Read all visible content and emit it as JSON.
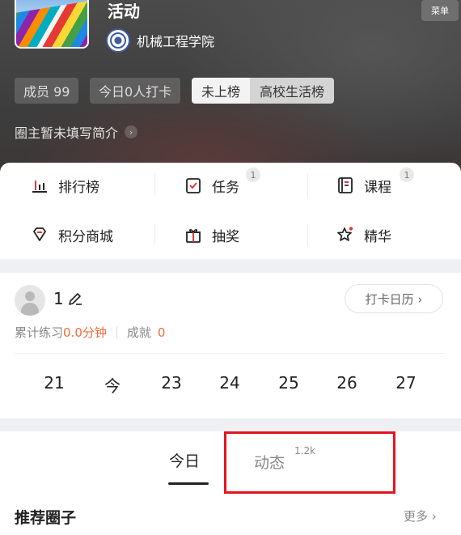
{
  "header": {
    "title": "活动",
    "menu_label": "菜单",
    "college_name": "机械工程学院",
    "members": "成员 99",
    "checkins_today": "今日0人打卡",
    "rank_not_listed": "未上榜",
    "rank_campus": "高校生活榜",
    "intro": "圈主暂未填写简介",
    "intro_chevron": "›"
  },
  "features": [
    {
      "label": "排行榜",
      "icon": "bar-chart-icon",
      "badge": ""
    },
    {
      "label": "任务",
      "icon": "task-check-icon",
      "badge": "1"
    },
    {
      "label": "课程",
      "icon": "course-book-icon",
      "badge": "1"
    },
    {
      "label": "积分商城",
      "icon": "diamond-icon",
      "badge": ""
    },
    {
      "label": "抽奖",
      "icon": "gift-icon",
      "badge": ""
    },
    {
      "label": "精华",
      "icon": "star-icon",
      "badge": ""
    }
  ],
  "stats": {
    "user_name": "1",
    "calendar_button": "打卡日历 ›",
    "practice_label": "累计练习",
    "practice_value": "0.0分钟",
    "achievement_label": "成就",
    "achievement_value": "0",
    "days": [
      "21",
      "今",
      "23",
      "24",
      "25",
      "26",
      "27"
    ]
  },
  "tabs": {
    "today": "今日",
    "dynamic": "动态",
    "dynamic_count": "1.2k"
  },
  "recommend": {
    "title": "推荐圈子",
    "more": "更多 ›"
  },
  "colors": {
    "accent_orange": "#ee6a3c",
    "highlight_red": "#e3151e",
    "header_bg": "#444444"
  }
}
